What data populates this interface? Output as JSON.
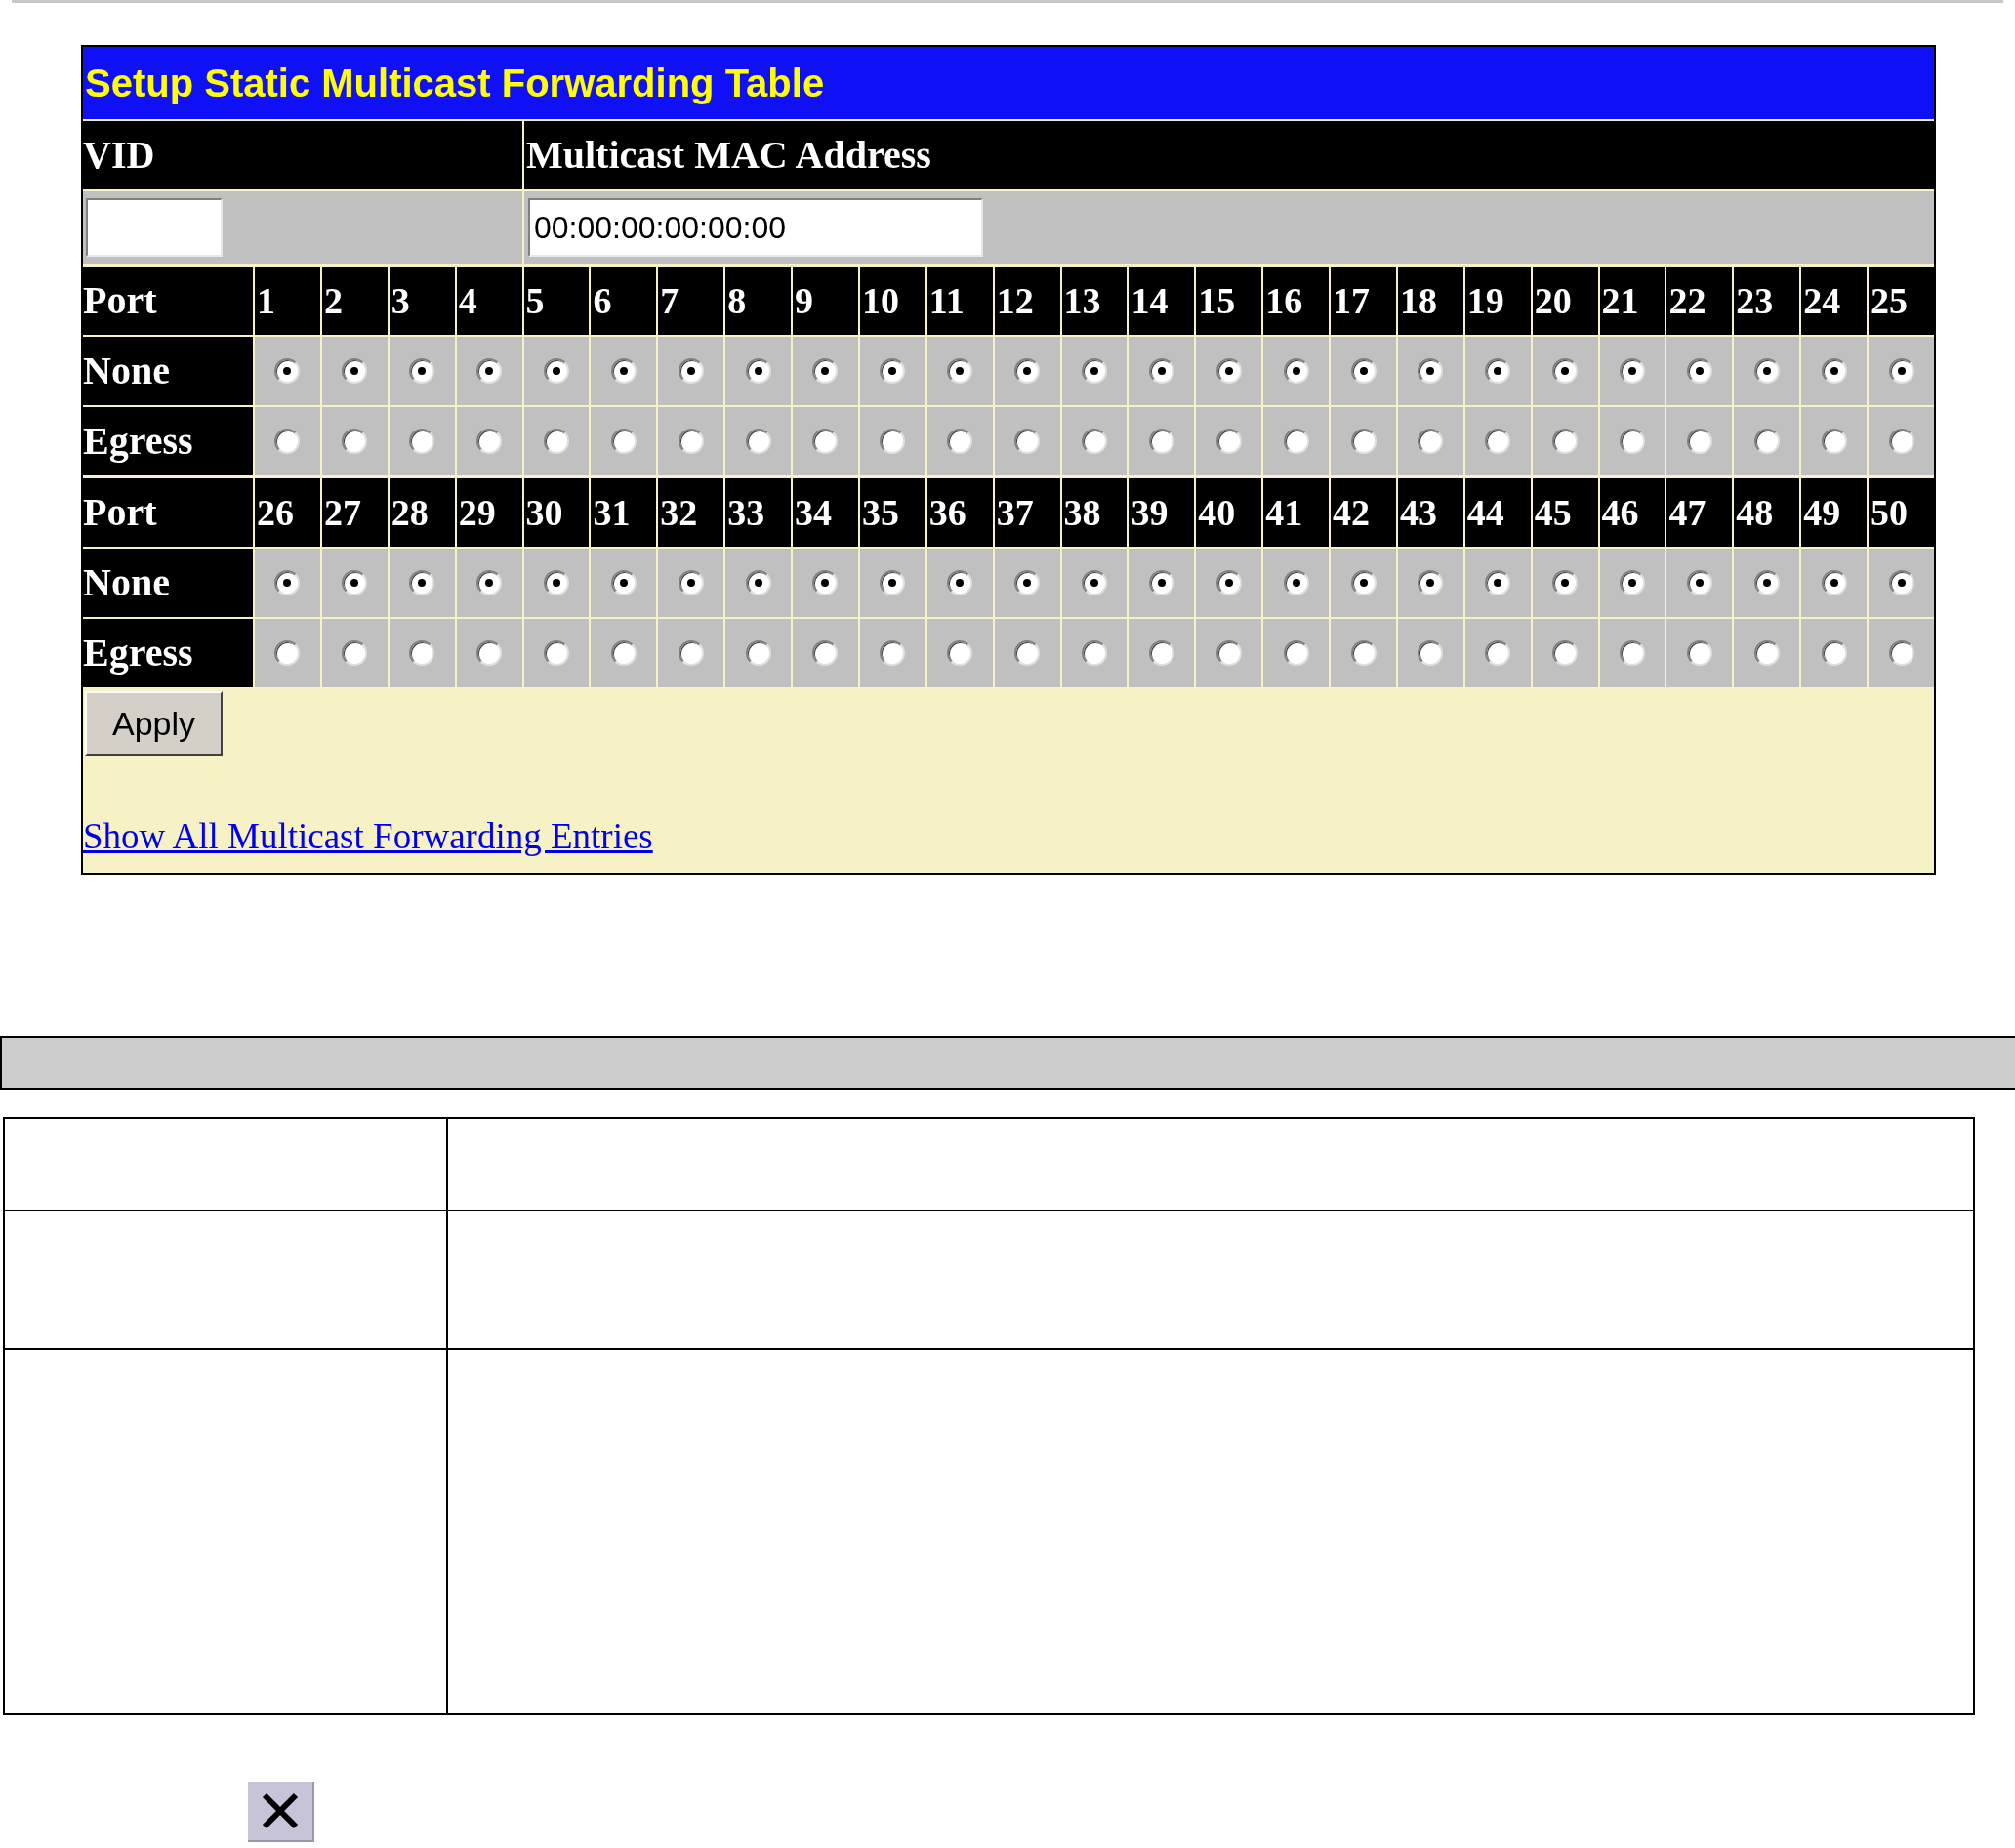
{
  "panel": {
    "title": "Setup Static Multicast Forwarding Table",
    "fields": [
      {
        "label": "VID"
      },
      {
        "label": "Multicast MAC Address",
        "value": "00:00:00:00:00:00"
      }
    ],
    "port_blocks": [
      {
        "header": "Port",
        "ports": [
          "1",
          "2",
          "3",
          "4",
          "5",
          "6",
          "7",
          "8",
          "9",
          "10",
          "11",
          "12",
          "13",
          "14",
          "15",
          "16",
          "17",
          "18",
          "19",
          "20",
          "21",
          "22",
          "23",
          "24",
          "25"
        ],
        "rows": [
          {
            "label": "None",
            "options": [
              {
                "selected": true
              },
              {
                "selected": true
              },
              {
                "selected": true
              },
              {
                "selected": true
              },
              {
                "selected": true
              },
              {
                "selected": true
              },
              {
                "selected": true
              },
              {
                "selected": true
              },
              {
                "selected": true
              },
              {
                "selected": true
              },
              {
                "selected": true
              },
              {
                "selected": true
              },
              {
                "selected": true
              },
              {
                "selected": true
              },
              {
                "selected": true
              },
              {
                "selected": true
              },
              {
                "selected": true
              },
              {
                "selected": true
              },
              {
                "selected": true
              },
              {
                "selected": true
              },
              {
                "selected": true
              },
              {
                "selected": true
              },
              {
                "selected": true
              },
              {
                "selected": true
              },
              {
                "selected": true
              }
            ]
          },
          {
            "label": "Egress",
            "options": [
              {
                "selected": false
              },
              {
                "selected": false
              },
              {
                "selected": false
              },
              {
                "selected": false
              },
              {
                "selected": false
              },
              {
                "selected": false
              },
              {
                "selected": false
              },
              {
                "selected": false
              },
              {
                "selected": false
              },
              {
                "selected": false
              },
              {
                "selected": false
              },
              {
                "selected": false
              },
              {
                "selected": false
              },
              {
                "selected": false
              },
              {
                "selected": false
              },
              {
                "selected": false
              },
              {
                "selected": false
              },
              {
                "selected": false
              },
              {
                "selected": false
              },
              {
                "selected": false
              },
              {
                "selected": false
              },
              {
                "selected": false
              },
              {
                "selected": false
              },
              {
                "selected": false
              },
              {
                "selected": false
              }
            ]
          }
        ]
      },
      {
        "header": "Port",
        "ports": [
          "26",
          "27",
          "28",
          "29",
          "30",
          "31",
          "32",
          "33",
          "34",
          "35",
          "36",
          "37",
          "38",
          "39",
          "40",
          "41",
          "42",
          "43",
          "44",
          "45",
          "46",
          "47",
          "48",
          "49",
          "50"
        ],
        "rows": [
          {
            "label": "None",
            "options": [
              {
                "selected": true
              },
              {
                "selected": true
              },
              {
                "selected": true
              },
              {
                "selected": true
              },
              {
                "selected": true
              },
              {
                "selected": true
              },
              {
                "selected": true
              },
              {
                "selected": true
              },
              {
                "selected": true
              },
              {
                "selected": true
              },
              {
                "selected": true
              },
              {
                "selected": true
              },
              {
                "selected": true
              },
              {
                "selected": true
              },
              {
                "selected": true
              },
              {
                "selected": true
              },
              {
                "selected": true
              },
              {
                "selected": true
              },
              {
                "selected": true
              },
              {
                "selected": true
              },
              {
                "selected": true
              },
              {
                "selected": true
              },
              {
                "selected": true
              },
              {
                "selected": true
              },
              {
                "selected": true
              }
            ]
          },
          {
            "label": "Egress",
            "options": [
              {
                "selected": false
              },
              {
                "selected": false
              },
              {
                "selected": false
              },
              {
                "selected": false
              },
              {
                "selected": false
              },
              {
                "selected": false
              },
              {
                "selected": false
              },
              {
                "selected": false
              },
              {
                "selected": false
              },
              {
                "selected": false
              },
              {
                "selected": false
              },
              {
                "selected": false
              },
              {
                "selected": false
              },
              {
                "selected": false
              },
              {
                "selected": false
              },
              {
                "selected": false
              },
              {
                "selected": false
              },
              {
                "selected": false
              },
              {
                "selected": false
              },
              {
                "selected": false
              },
              {
                "selected": false
              },
              {
                "selected": false
              },
              {
                "selected": false
              },
              {
                "selected": false
              },
              {
                "selected": false
              }
            ]
          }
        ]
      }
    ],
    "apply_button": "Apply",
    "link": "Show All Multicast Forwarding Entries"
  }
}
